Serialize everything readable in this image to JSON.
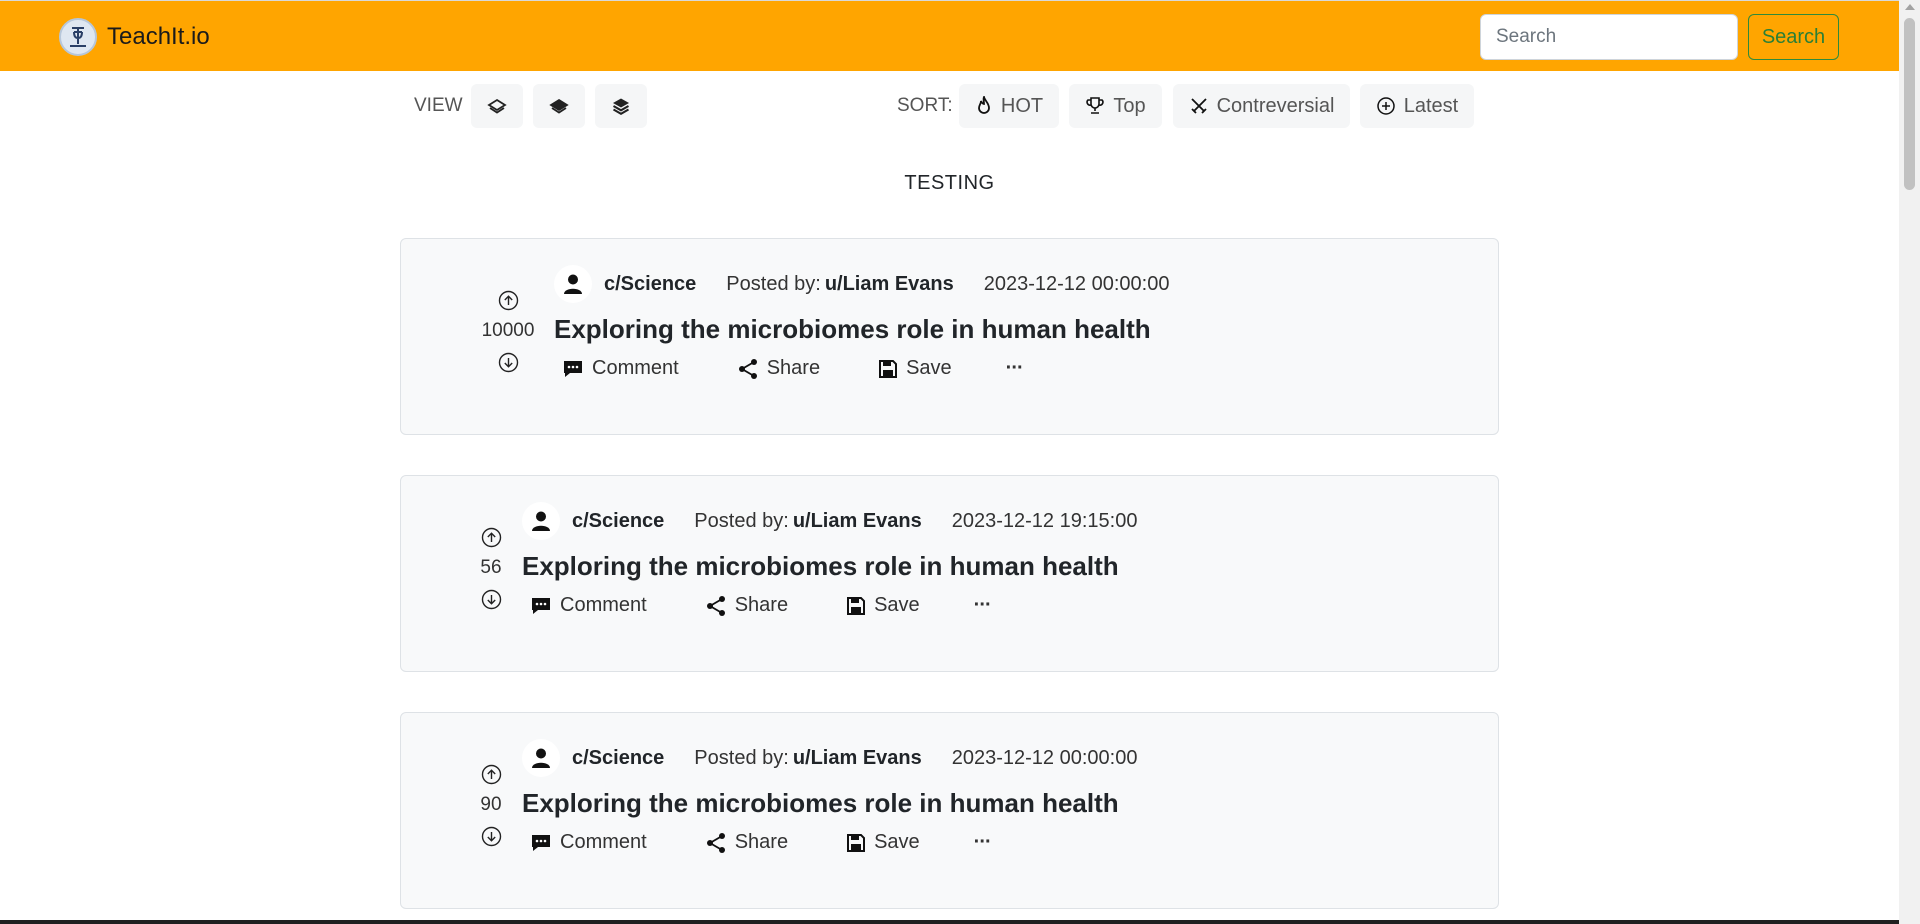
{
  "navbar": {
    "brand_name": "TeachIt.io",
    "search_placeholder": "Search",
    "search_button_label": "Search",
    "background_color": "#ffa500"
  },
  "toolbar": {
    "view_label": "VIEW",
    "view_buttons": [
      {
        "icon": "layers-outline-icon"
      },
      {
        "icon": "layers-half-icon"
      },
      {
        "icon": "layers-filled-icon"
      }
    ],
    "sort_label": "SORT:",
    "sort_options": [
      {
        "label": "HOT",
        "icon": "fire-icon"
      },
      {
        "label": "Top",
        "icon": "trophy-icon"
      },
      {
        "label": "Contreversial",
        "icon": "crossed-swords-icon"
      },
      {
        "label": "Latest",
        "icon": "plus-circle-icon"
      }
    ]
  },
  "section_title": "TESTING",
  "posts": [
    {
      "votes": "10000",
      "community": "c/Science",
      "posted_by_label": "Posted by:",
      "username": "u/Liam Evans",
      "timestamp": "2023-12-12 00:00:00",
      "title": "Exploring the microbiomes role in human health",
      "actions": {
        "comment": "Comment",
        "share": "Share",
        "save": "Save",
        "more": "···"
      }
    },
    {
      "votes": "56",
      "community": "c/Science",
      "posted_by_label": "Posted by:",
      "username": "u/Liam Evans",
      "timestamp": "2023-12-12 19:15:00",
      "title": "Exploring the microbiomes role in human health",
      "actions": {
        "comment": "Comment",
        "share": "Share",
        "save": "Save",
        "more": "···"
      }
    },
    {
      "votes": "90",
      "community": "c/Science",
      "posted_by_label": "Posted by:",
      "username": "u/Liam Evans",
      "timestamp": "2023-12-12 00:00:00",
      "title": "Exploring the microbiomes role in human health",
      "actions": {
        "comment": "Comment",
        "share": "Share",
        "save": "Save",
        "more": "···"
      }
    }
  ]
}
